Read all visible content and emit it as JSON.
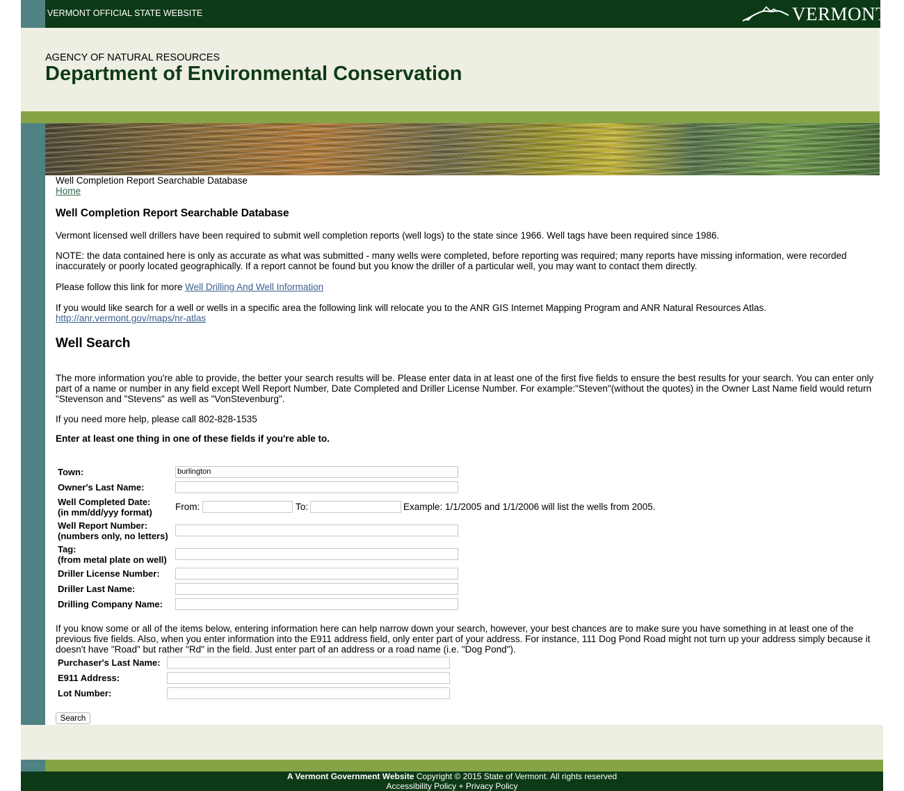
{
  "topbar": {
    "label": "VERMONT OFFICIAL STATE WEBSITE",
    "logo_text": "VERMONT"
  },
  "header": {
    "agency": "AGENCY OF NATURAL RESOURCES",
    "department": "Department of Environmental Conservation"
  },
  "breadcrumb": {
    "title": "Well Completion Report Searchable Database",
    "home": "Home"
  },
  "main": {
    "heading": "Well Completion Report Searchable Database",
    "intro": "Vermont licensed well drillers have been required to submit well completion reports (well logs) to the state since 1966. Well tags have been required since 1986.",
    "note": "NOTE: the data contained here is only as accurate as what was submitted - many wells were completed, before reporting was required; many reports have missing information, were recorded inaccurately or poorly located geographically. If a report cannot be found but you know the driller of a particular well, you may want to contact them directly.",
    "follow_prefix": "Please follow this link for more ",
    "follow_link": "Well Drilling And Well Information",
    "area_text": "If you would like search for a well or wells in a specific area the following link will relocate you to the ANR GIS Internet Mapping Program and ANR Natural Resources Atlas.",
    "area_link": "http://anr.vermont.gov/maps/nr-atlas",
    "search_heading": "Well Search",
    "search_help": "The more information you're able to provide, the better your search results will be. Please enter data in at least one of the first five fields to ensure the best results for your search. You can enter only part of a name or number in any field except Well Report Number, Date Completed and Driller License Number. For example:\"Steven\"(without the quotes) in the Owner Last Name field would return \"Stevenson and \"Stevens\" as well as \"VonStevenburg\".",
    "phone_help": "If you need more help, please call 802-828-1535",
    "enter_one": "Enter at least one thing in one of these fields if you're able to.",
    "narrow_help": "If you know some or all of the items below, entering information here can help narrow down your search, however, your best chances are to make sure you have something in at least one of the previous five fields. Also, when you enter information into the E911 address field, only enter part of your address. For instance, 111 Dog Pond Road might not turn up your address simply because it doesn't have \"Road\" but rather \"Rd\" in the field. Just enter part of an address or a road name (i.e. \"Dog Pond\")."
  },
  "form": {
    "town_label": "Town:",
    "town_value": "burlington",
    "owner_label": "Owner's Last Name:",
    "date_label_1": "Well Completed Date:",
    "date_label_2": "(in mm/dd/yyy format)",
    "from_label": "From:",
    "to_label": "To:",
    "date_example": "Example: 1/1/2005 and 1/1/2006 will list the wells from 2005.",
    "report_label_1": "Well Report Number:",
    "report_label_2": "(numbers only, no letters)",
    "tag_label_1": "Tag:",
    "tag_label_2": "(from metal plate on well)",
    "license_label": "Driller License Number:",
    "driller_label": "Driller Last Name:",
    "company_label": "Drilling Company Name:",
    "purchaser_label": "Purchaser's Last Name:",
    "e911_label": "E911 Address:",
    "lot_label": "Lot Number:",
    "search_button": "Search"
  },
  "footer": {
    "gov_site": "A Vermont Government Website",
    "copyright": " Copyright © 2015 State of Vermont. All rights reserved",
    "policies": "Accessibility Policy + Privacy Policy"
  }
}
